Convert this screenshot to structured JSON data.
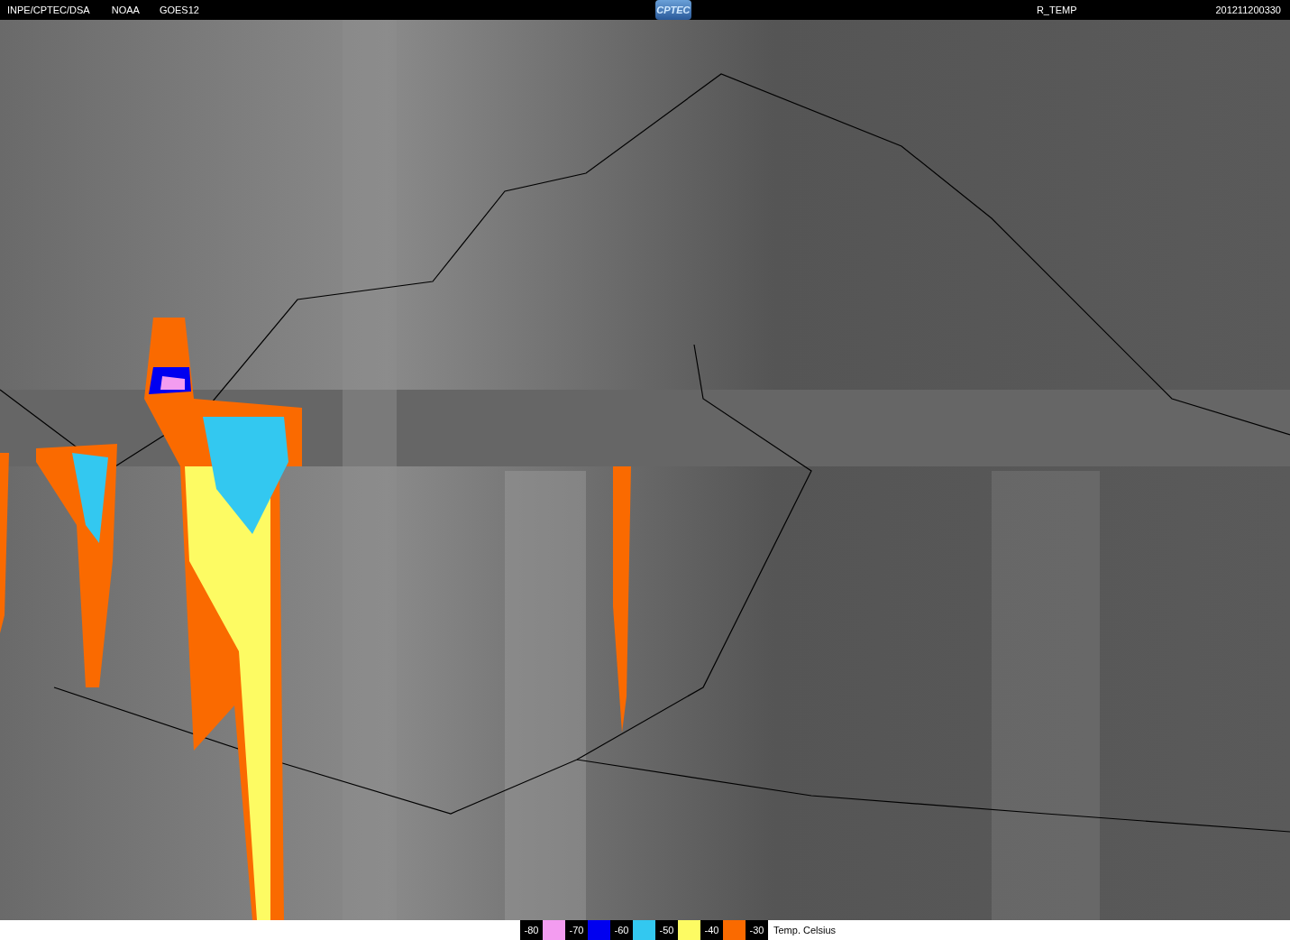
{
  "header": {
    "source": "INPE/CPTEC/DSA",
    "agency": "NOAA",
    "satellite": "GOES12",
    "logo": "CPTEC",
    "product": "R_TEMP",
    "timestamp": "201211200330"
  },
  "legend": {
    "items": [
      {
        "label": "-80",
        "color": "#f39cf0"
      },
      {
        "label": "-70",
        "color": "#0000f0"
      },
      {
        "label": "-60",
        "color": "#33c8f0"
      },
      {
        "label": "-50",
        "color": "#fdfb63"
      },
      {
        "label": "-40",
        "color": "#fa6a00"
      },
      {
        "label": "-30"
      }
    ],
    "unit": "Temp. Celsius"
  }
}
